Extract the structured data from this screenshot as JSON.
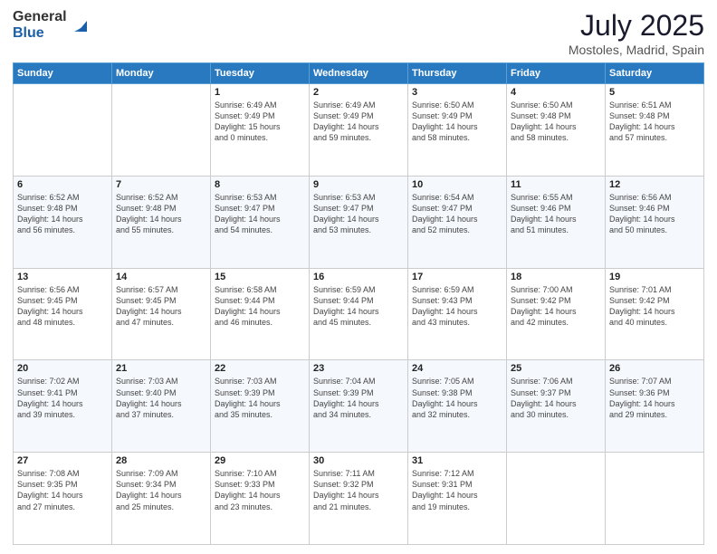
{
  "logo": {
    "general": "General",
    "blue": "Blue"
  },
  "title": {
    "month": "July 2025",
    "location": "Mostoles, Madrid, Spain"
  },
  "headers": [
    "Sunday",
    "Monday",
    "Tuesday",
    "Wednesday",
    "Thursday",
    "Friday",
    "Saturday"
  ],
  "weeks": [
    [
      {
        "day": "",
        "info": ""
      },
      {
        "day": "",
        "info": ""
      },
      {
        "day": "1",
        "info": "Sunrise: 6:49 AM\nSunset: 9:49 PM\nDaylight: 15 hours\nand 0 minutes."
      },
      {
        "day": "2",
        "info": "Sunrise: 6:49 AM\nSunset: 9:49 PM\nDaylight: 14 hours\nand 59 minutes."
      },
      {
        "day": "3",
        "info": "Sunrise: 6:50 AM\nSunset: 9:49 PM\nDaylight: 14 hours\nand 58 minutes."
      },
      {
        "day": "4",
        "info": "Sunrise: 6:50 AM\nSunset: 9:48 PM\nDaylight: 14 hours\nand 58 minutes."
      },
      {
        "day": "5",
        "info": "Sunrise: 6:51 AM\nSunset: 9:48 PM\nDaylight: 14 hours\nand 57 minutes."
      }
    ],
    [
      {
        "day": "6",
        "info": "Sunrise: 6:52 AM\nSunset: 9:48 PM\nDaylight: 14 hours\nand 56 minutes."
      },
      {
        "day": "7",
        "info": "Sunrise: 6:52 AM\nSunset: 9:48 PM\nDaylight: 14 hours\nand 55 minutes."
      },
      {
        "day": "8",
        "info": "Sunrise: 6:53 AM\nSunset: 9:47 PM\nDaylight: 14 hours\nand 54 minutes."
      },
      {
        "day": "9",
        "info": "Sunrise: 6:53 AM\nSunset: 9:47 PM\nDaylight: 14 hours\nand 53 minutes."
      },
      {
        "day": "10",
        "info": "Sunrise: 6:54 AM\nSunset: 9:47 PM\nDaylight: 14 hours\nand 52 minutes."
      },
      {
        "day": "11",
        "info": "Sunrise: 6:55 AM\nSunset: 9:46 PM\nDaylight: 14 hours\nand 51 minutes."
      },
      {
        "day": "12",
        "info": "Sunrise: 6:56 AM\nSunset: 9:46 PM\nDaylight: 14 hours\nand 50 minutes."
      }
    ],
    [
      {
        "day": "13",
        "info": "Sunrise: 6:56 AM\nSunset: 9:45 PM\nDaylight: 14 hours\nand 48 minutes."
      },
      {
        "day": "14",
        "info": "Sunrise: 6:57 AM\nSunset: 9:45 PM\nDaylight: 14 hours\nand 47 minutes."
      },
      {
        "day": "15",
        "info": "Sunrise: 6:58 AM\nSunset: 9:44 PM\nDaylight: 14 hours\nand 46 minutes."
      },
      {
        "day": "16",
        "info": "Sunrise: 6:59 AM\nSunset: 9:44 PM\nDaylight: 14 hours\nand 45 minutes."
      },
      {
        "day": "17",
        "info": "Sunrise: 6:59 AM\nSunset: 9:43 PM\nDaylight: 14 hours\nand 43 minutes."
      },
      {
        "day": "18",
        "info": "Sunrise: 7:00 AM\nSunset: 9:42 PM\nDaylight: 14 hours\nand 42 minutes."
      },
      {
        "day": "19",
        "info": "Sunrise: 7:01 AM\nSunset: 9:42 PM\nDaylight: 14 hours\nand 40 minutes."
      }
    ],
    [
      {
        "day": "20",
        "info": "Sunrise: 7:02 AM\nSunset: 9:41 PM\nDaylight: 14 hours\nand 39 minutes."
      },
      {
        "day": "21",
        "info": "Sunrise: 7:03 AM\nSunset: 9:40 PM\nDaylight: 14 hours\nand 37 minutes."
      },
      {
        "day": "22",
        "info": "Sunrise: 7:03 AM\nSunset: 9:39 PM\nDaylight: 14 hours\nand 35 minutes."
      },
      {
        "day": "23",
        "info": "Sunrise: 7:04 AM\nSunset: 9:39 PM\nDaylight: 14 hours\nand 34 minutes."
      },
      {
        "day": "24",
        "info": "Sunrise: 7:05 AM\nSunset: 9:38 PM\nDaylight: 14 hours\nand 32 minutes."
      },
      {
        "day": "25",
        "info": "Sunrise: 7:06 AM\nSunset: 9:37 PM\nDaylight: 14 hours\nand 30 minutes."
      },
      {
        "day": "26",
        "info": "Sunrise: 7:07 AM\nSunset: 9:36 PM\nDaylight: 14 hours\nand 29 minutes."
      }
    ],
    [
      {
        "day": "27",
        "info": "Sunrise: 7:08 AM\nSunset: 9:35 PM\nDaylight: 14 hours\nand 27 minutes."
      },
      {
        "day": "28",
        "info": "Sunrise: 7:09 AM\nSunset: 9:34 PM\nDaylight: 14 hours\nand 25 minutes."
      },
      {
        "day": "29",
        "info": "Sunrise: 7:10 AM\nSunset: 9:33 PM\nDaylight: 14 hours\nand 23 minutes."
      },
      {
        "day": "30",
        "info": "Sunrise: 7:11 AM\nSunset: 9:32 PM\nDaylight: 14 hours\nand 21 minutes."
      },
      {
        "day": "31",
        "info": "Sunrise: 7:12 AM\nSunset: 9:31 PM\nDaylight: 14 hours\nand 19 minutes."
      },
      {
        "day": "",
        "info": ""
      },
      {
        "day": "",
        "info": ""
      }
    ]
  ]
}
